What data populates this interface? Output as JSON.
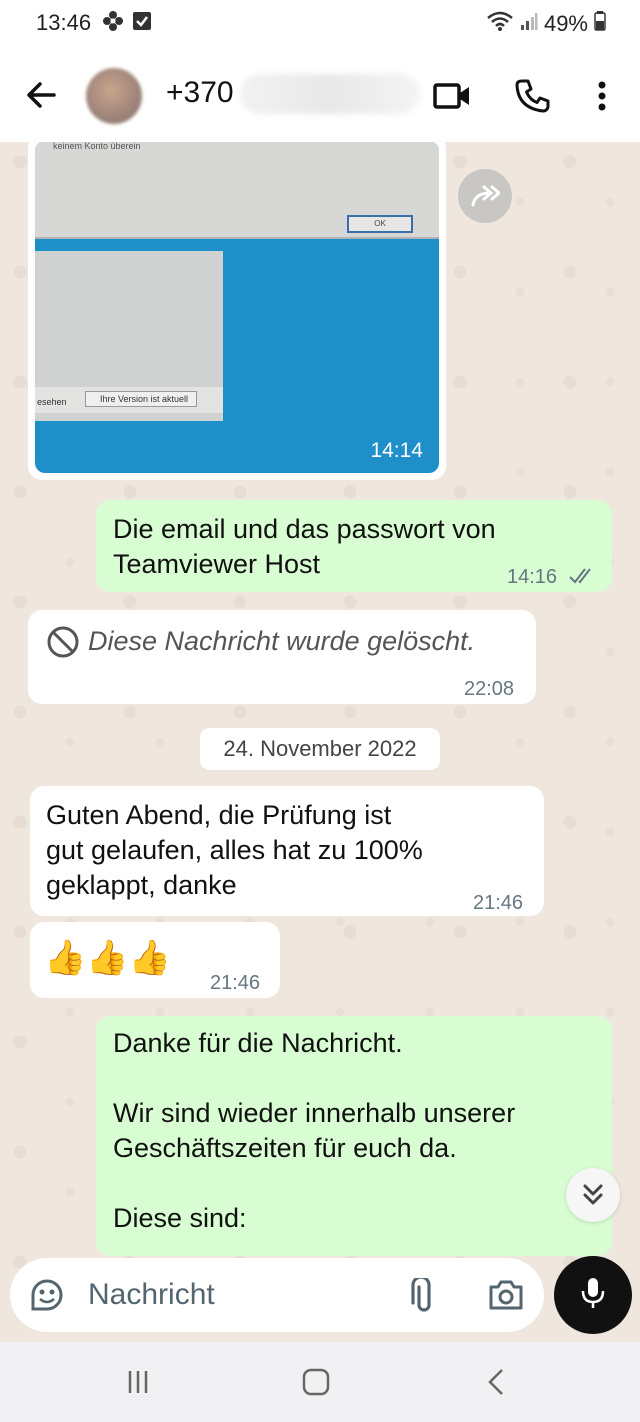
{
  "status_bar": {
    "time": "13:46",
    "battery": "49%",
    "icons": [
      "flower-icon",
      "checkbox-icon",
      "wifi-icon",
      "signal-icon",
      "battery-icon"
    ]
  },
  "header": {
    "contact_number": "+370",
    "icons": [
      "back-arrow-icon",
      "video-call-icon",
      "phone-icon",
      "more-options-icon"
    ]
  },
  "messages": [
    {
      "type": "image",
      "direction": "incoming",
      "time": "14:14",
      "image_text": {
        "dialog_text": "keinem Konto überein",
        "button_text": "OK",
        "status_left": "esehen",
        "status_right": "Ihre Version ist aktuell"
      }
    },
    {
      "type": "text",
      "direction": "outgoing",
      "text_line1": "Die email und das passwort von",
      "text_line2": "Teamviewer Host",
      "time": "14:16"
    },
    {
      "type": "deleted",
      "direction": "incoming",
      "text": "Diese Nachricht wurde gelöscht.",
      "time": "22:08"
    },
    {
      "type": "date",
      "text": "24. November 2022"
    },
    {
      "type": "text",
      "direction": "incoming",
      "text_line1": "Guten Abend, die Prüfung ist",
      "text_line2": "gut gelaufen, alles hat zu 100%",
      "text_line3": "geklappt, danke",
      "time": "21:46"
    },
    {
      "type": "emoji",
      "direction": "incoming",
      "text": "👍👍👍",
      "time": "21:46"
    },
    {
      "type": "text",
      "direction": "outgoing",
      "text_line1": "Danke für die Nachricht.",
      "text_line2": "Wir sind wieder innerhalb unserer",
      "text_line3": "Geschäftszeiten für euch da.",
      "text_line4": "Diese sind:"
    }
  ],
  "composer": {
    "placeholder": "Nachricht",
    "icons": [
      "sticker-icon",
      "attach-icon",
      "camera-icon",
      "mic-icon"
    ]
  },
  "colors": {
    "outgoing_bubble": "#d9fdd3",
    "incoming_bubble": "#ffffff",
    "chat_background": "#efe7de",
    "tick_color": "#667781"
  }
}
